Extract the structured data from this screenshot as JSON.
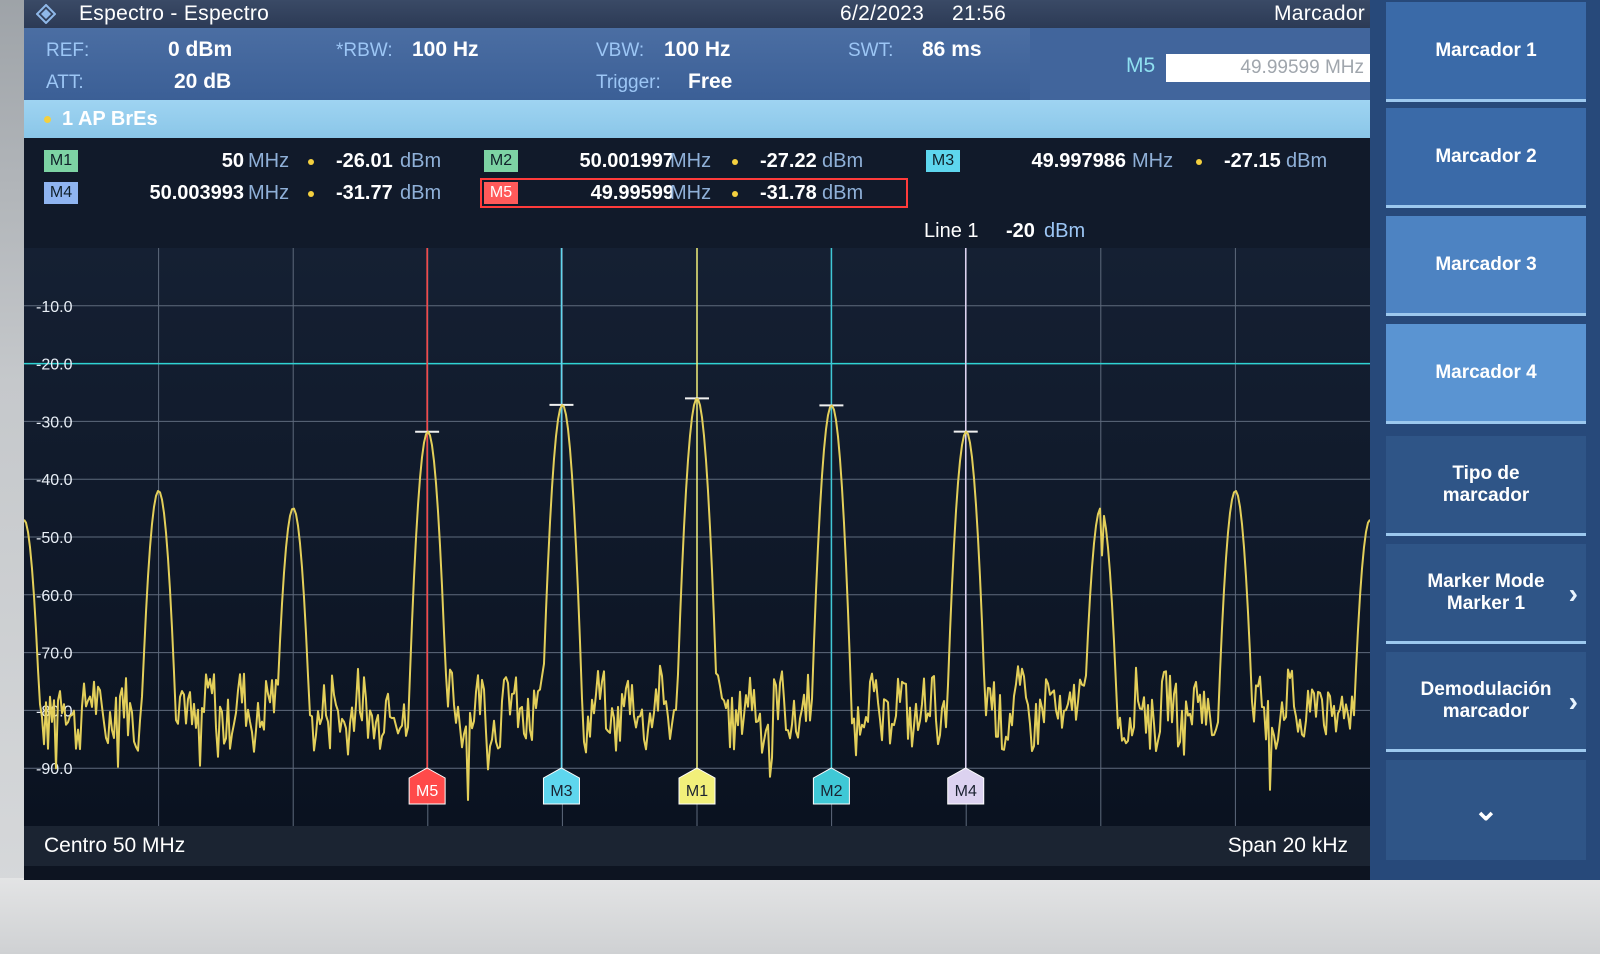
{
  "title_bar": {
    "app_title": "Espectro - Espectro",
    "date": "6/2/2023",
    "time": "21:56",
    "menu_title": "Marcador"
  },
  "settings": {
    "ref_label": "REF:",
    "ref_value": "0 dBm",
    "att_label": "ATT:",
    "att_value": "20 dB",
    "rbw_label": "*RBW:",
    "rbw_value": "100 Hz",
    "vbw_label": "VBW:",
    "vbw_value": "100 Hz",
    "trigger_label": "Trigger:",
    "trigger_value": "Free",
    "swt_label": "SWT:",
    "swt_value": "86 ms",
    "marker_input_label": "M5",
    "marker_input_value": "49.99599 MHz"
  },
  "trace": {
    "label": "1 AP  BrEs"
  },
  "markers": [
    {
      "name": "M1",
      "freq": "50",
      "freq_unit": "MHz",
      "level": "-26.01",
      "level_unit": "dBm",
      "color": "#7dd3a4"
    },
    {
      "name": "M2",
      "freq": "50.001997",
      "freq_unit": "MHz",
      "level": "-27.22",
      "level_unit": "dBm",
      "color": "#7dd3a4"
    },
    {
      "name": "M3",
      "freq": "49.997986",
      "freq_unit": "MHz",
      "level": "-27.15",
      "level_unit": "dBm",
      "color": "#5ed6ee"
    },
    {
      "name": "M4",
      "freq": "50.003993",
      "freq_unit": "MHz",
      "level": "-31.77",
      "level_unit": "dBm",
      "color": "#8fb4f0"
    },
    {
      "name": "M5",
      "freq": "49.99599",
      "freq_unit": "MHz",
      "level": "-31.78",
      "level_unit": "dBm",
      "color": "#ff5a5a"
    }
  ],
  "line_info": {
    "name": "Line 1",
    "value": "-20",
    "unit": "dBm"
  },
  "plot": {
    "y_ticks": [
      "-10.0",
      "-20.0",
      "-30.0",
      "-40.0",
      "-50.0",
      "-60.0",
      "-70.0",
      "-80.0",
      "-90.0"
    ],
    "center": "Centro 50 MHz",
    "span": "Span 20 kHz",
    "marker_flags": [
      "M5",
      "M3",
      "M1",
      "M2",
      "M4"
    ]
  },
  "softkeys": [
    {
      "label": "Marcador 1",
      "arrow": ""
    },
    {
      "label": "Marcador 2",
      "arrow": ""
    },
    {
      "label": "Marcador 3",
      "arrow": ""
    },
    {
      "label": "Marcador 4",
      "arrow": ""
    },
    {
      "label": "Tipo de marcador",
      "arrow": ""
    },
    {
      "label": "Marker Mode Marker 1",
      "arrow": "›"
    },
    {
      "label": "Demodulación marcador",
      "arrow": "›"
    },
    {
      "label": "",
      "arrow": "⌄"
    }
  ],
  "colors": {
    "trace": "#e3cf5a",
    "grid": "#5e6a7c",
    "display_line": "#2fd3d3",
    "marker_m1": "#f1ef7a",
    "marker_m2": "#3fc8d6",
    "marker_m3": "#5ed6ee",
    "marker_m4": "#dcd2f0",
    "marker_m5": "#ff4a4a"
  },
  "chart_data": {
    "type": "line",
    "x": [
      49.99,
      49.992,
      49.994,
      49.996,
      49.998,
      50.0,
      50.002,
      50.004,
      50.006,
      50.008,
      50.01
    ],
    "series": [
      {
        "values": [
          -47,
          -42,
          -45,
          -31.78,
          -27.15,
          -26.01,
          -27.22,
          -31.77,
          -45,
          -42,
          -47
        ]
      }
    ],
    "xlabel": "",
    "ylabel": "",
    "ylim": [
      -100,
      0
    ],
    "grid": true
  }
}
